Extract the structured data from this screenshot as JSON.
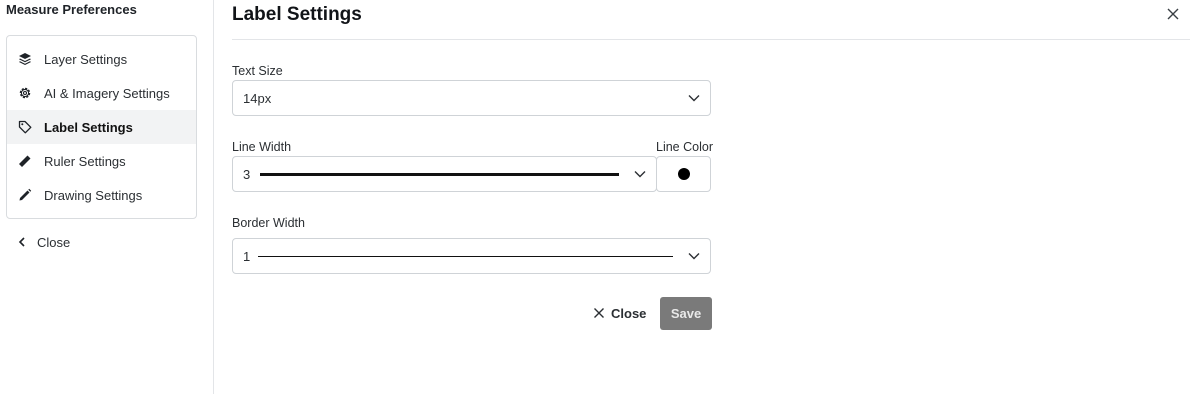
{
  "sidebar": {
    "title": "Measure Preferences",
    "items": [
      {
        "label": "Layer Settings",
        "icon": "layers-icon",
        "active": false
      },
      {
        "label": "AI & Imagery Settings",
        "icon": "gear-icon",
        "active": false
      },
      {
        "label": "Label Settings",
        "icon": "tag-icon",
        "active": true
      },
      {
        "label": "Ruler Settings",
        "icon": "ruler-icon",
        "active": false
      },
      {
        "label": "Drawing Settings",
        "icon": "pencil-icon",
        "active": false
      }
    ],
    "close_label": "Close"
  },
  "main": {
    "title": "Label Settings",
    "text_size": {
      "label": "Text Size",
      "value": "14px"
    },
    "line_width": {
      "label": "Line Width",
      "value": "3"
    },
    "line_color": {
      "label": "Line Color",
      "value": "#000000"
    },
    "border_width": {
      "label": "Border Width",
      "value": "1"
    },
    "close_label": "Close",
    "save_label": "Save"
  },
  "colors": {
    "active_bg": "#f2f3f4",
    "save_button_bg": "#7a7a7a",
    "border": "#cfd3d7"
  }
}
